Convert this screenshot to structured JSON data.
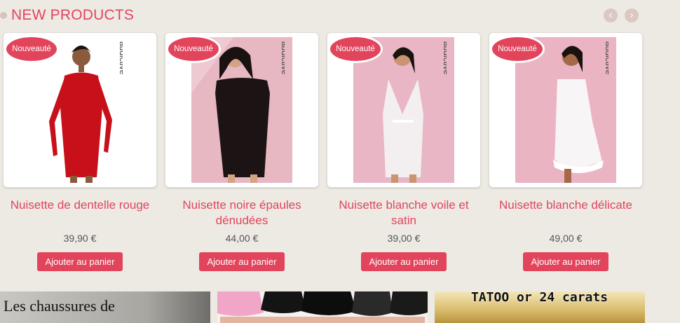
{
  "section": {
    "title": "NEW PRODUCTS"
  },
  "nav": {
    "prev_icon": "‹",
    "next_icon": "›"
  },
  "badge_label": "Nouveauté",
  "brand_label": "addictive",
  "products": [
    {
      "name": "Nuisette de dentelle rouge",
      "price": "39,90 €",
      "button": "Ajouter au panier",
      "dress_color": "#c8101a",
      "bg": "#ffffff"
    },
    {
      "name": "Nuisette noire épaules dénudées",
      "price": "44,00 €",
      "button": "Ajouter au panier",
      "dress_color": "#1c1414",
      "bg": "#e7b7c2"
    },
    {
      "name": "Nuisette blanche voile et satin",
      "price": "39,00 €",
      "button": "Ajouter au panier",
      "dress_color": "#f3eef0",
      "bg": "#e9b6c5"
    },
    {
      "name": "Nuisette blanche délicate",
      "price": "49,00 €",
      "button": "Ajouter au panier",
      "dress_color": "#f8f5f6",
      "bg": "#eab4c3"
    }
  ],
  "banners": [
    {
      "text": "Les chaussures de"
    },
    {
      "text": ""
    },
    {
      "text": "TATOO or 24 carats"
    }
  ],
  "colors": {
    "accent": "#e2445c",
    "background": "#edeae4"
  }
}
